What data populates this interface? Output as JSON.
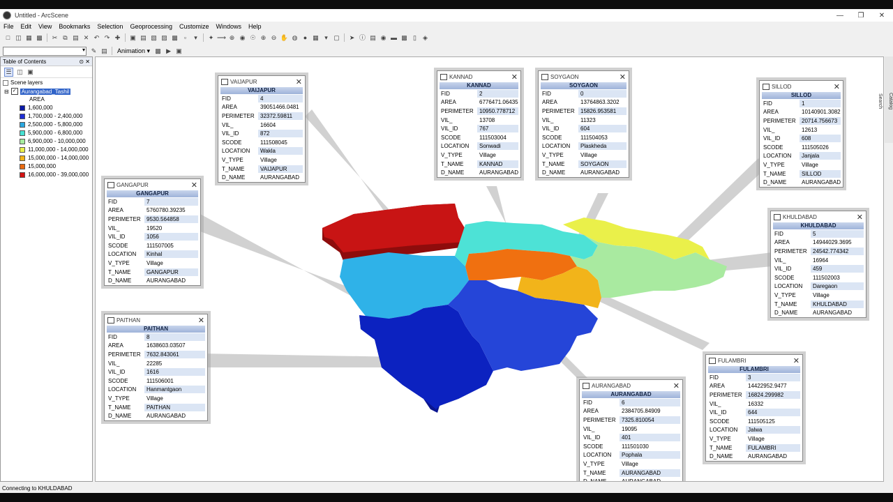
{
  "window": {
    "title": "Untitled - ArcScene"
  },
  "menu": [
    "File",
    "Edit",
    "View",
    "Bookmarks",
    "Selection",
    "Geoprocessing",
    "Customize",
    "Windows",
    "Help"
  ],
  "toolbar": {
    "animation_label": "Animation ▾"
  },
  "toc": {
    "title": "Table of Contents",
    "root": "Scene layers",
    "layer": "Aurangabad_Tashil",
    "field": "AREA",
    "legend": [
      {
        "label": "1,600,000",
        "color": "#0a1aa8"
      },
      {
        "label": "1,700,000 - 2,400,000",
        "color": "#1f2fd6"
      },
      {
        "label": "2,500,000 - 5,800,000",
        "color": "#2ba8e0"
      },
      {
        "label": "5,900,000 - 6,800,000",
        "color": "#46e0d2"
      },
      {
        "label": "6,900,000 - 10,000,000",
        "color": "#a6ec9e"
      },
      {
        "label": "11,000,000 - 14,000,000",
        "color": "#eaf04a"
      },
      {
        "label": "15,000,000 - 14,000,000",
        "color": "#f2b418"
      },
      {
        "label": "15,000,000",
        "color": "#ea6a10"
      },
      {
        "label": "16,000,000 - 39,000,000",
        "color": "#d41212"
      }
    ]
  },
  "side_tabs": [
    "Catalog",
    "Search"
  ],
  "status": "Connecting to KHULDABAD",
  "field_names": [
    "FID",
    "AREA",
    "PERIMETER",
    "VIL_",
    "VIL_ID",
    "SCODE",
    "LOCATION",
    "V_TYPE",
    "T_NAME",
    "D_NAME"
  ],
  "popups": [
    {
      "id": "vaijapur",
      "title": "VAIJAPUR",
      "values": [
        "4",
        "39051466.0481",
        "32372.59811",
        "16604",
        "872",
        "111508045",
        "Wakla",
        "Village",
        "VAIJAPUR",
        "AURANGABAD"
      ]
    },
    {
      "id": "kannad",
      "title": "KANNAD",
      "values": [
        "2",
        "6776471.06435",
        "10950.778712",
        "13708",
        "767",
        "111503004",
        "Sonwadi",
        "Village",
        "KANNAD",
        "AURANGABAD"
      ]
    },
    {
      "id": "soygaon",
      "title": "SOYGAON",
      "values": [
        "0",
        "13764863.3202",
        "15826.953581",
        "11323",
        "604",
        "111504053",
        "Plaskheda",
        "Village",
        "SOYGAON",
        "AURANGABAD"
      ]
    },
    {
      "id": "sillod",
      "title": "SILLOD",
      "values": [
        "1",
        "10140901.3082",
        "20714.756673",
        "12613",
        "608",
        "111505026",
        "Janjala",
        "Village",
        "SILLOD",
        "AURANGABAD"
      ]
    },
    {
      "id": "gangapur",
      "title": "GANGAPUR",
      "values": [
        "7",
        "5760780.39235",
        "9530.564858",
        "19520",
        "1056",
        "111507005",
        "Kinhal",
        "Village",
        "GANGAPUR",
        "AURANGABAD"
      ]
    },
    {
      "id": "khuldabad",
      "title": "KHULDABAD",
      "values": [
        "5",
        "14944029.3695",
        "24542.774342",
        "16964",
        "459",
        "111502003",
        "Daregaon",
        "Village",
        "KHULDABAD",
        "AURANGABAD"
      ]
    },
    {
      "id": "paithan",
      "title": "PAITHAN",
      "values": [
        "8",
        "1638603.03507",
        "7632.843061",
        "22285",
        "1616",
        "111506001",
        "Hanmantgaon",
        "Village",
        "PAITHAN",
        "AURANGABAD"
      ]
    },
    {
      "id": "fulambri",
      "title": "FULAMBRI",
      "values": [
        "3",
        "14422952.9477",
        "16824.299982",
        "16332",
        "644",
        "111505125",
        "Jalwa",
        "Village",
        "FULAMBRI",
        "AURANGABAD"
      ]
    },
    {
      "id": "aurangabad",
      "title": "AURANGABAD",
      "values": [
        "6",
        "2384705.84909",
        "7325.810054",
        "19095",
        "401",
        "111501030",
        "Pophala",
        "Village",
        "AURANGABAD",
        "AURANGABAD"
      ]
    }
  ]
}
